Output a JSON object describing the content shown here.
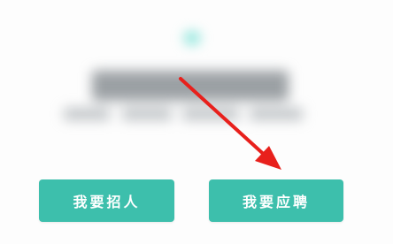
{
  "colors": {
    "button_bg": "#3dbfac",
    "button_text": "#ffffff",
    "arrow": "#e8201c",
    "accent_dot": "#7fe3d8"
  },
  "buttons": {
    "recruit_label": "我要招人",
    "apply_label": "我要应聘"
  },
  "annotation": {
    "icon": "red-arrow-icon",
    "points_to": "apply-button"
  }
}
